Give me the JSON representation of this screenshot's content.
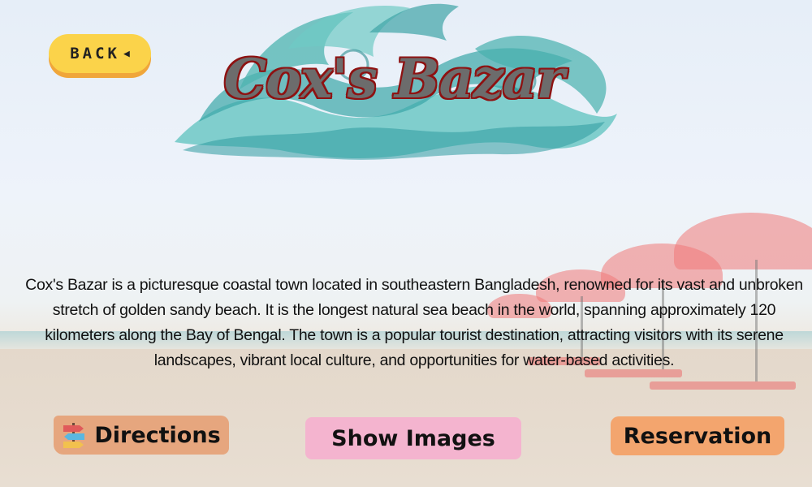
{
  "header": {
    "back_label": "BACK",
    "back_arrow": "◀",
    "logo_text": "Cox's Bazar"
  },
  "main": {
    "description": "Cox's Bazar is a picturesque coastal town located in southeastern Bangladesh, renowned for its vast and unbroken stretch of golden sandy beach. It is the longest natural sea beach in the world, spanning approximately 120 kilometers along the Bay of Bengal. The town is a popular tourist destination, attracting visitors with its serene landscapes, vibrant local culture, and opportunities for water-based activities."
  },
  "actions": {
    "directions_label": "Directions",
    "directions_icon": "signpost-icon",
    "show_images_label": "Show Images",
    "reservation_label": "Reservation"
  },
  "colors": {
    "back_button": "#fbd34a",
    "back_shadow": "#f0a63a",
    "logo_wave": "#4fb8b4",
    "logo_text": "#6c6c6c",
    "logo_outline": "#8e1212",
    "directions_bg": "#e6a67e",
    "show_images_bg": "#f4b4cf",
    "reservation_bg": "#f3a56e"
  }
}
